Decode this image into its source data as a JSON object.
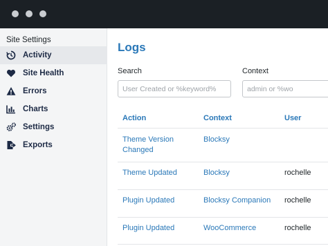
{
  "window": {
    "controls": [
      "close",
      "minimize",
      "maximize"
    ]
  },
  "sidebar": {
    "title": "Site Settings",
    "items": [
      {
        "label": "Activity",
        "icon": "history-icon",
        "active": true
      },
      {
        "label": "Site Health",
        "icon": "heart-icon",
        "active": false
      },
      {
        "label": "Errors",
        "icon": "warning-icon",
        "active": false
      },
      {
        "label": "Charts",
        "icon": "bar-chart-icon",
        "active": false
      },
      {
        "label": "Settings",
        "icon": "gears-icon",
        "active": false
      },
      {
        "label": "Exports",
        "icon": "export-icon",
        "active": false
      }
    ]
  },
  "main": {
    "title": "Logs",
    "filters": {
      "search": {
        "label": "Search",
        "placeholder": "User Created or %keyword%"
      },
      "context": {
        "label": "Context",
        "placeholder": "admin or %wo"
      }
    },
    "table": {
      "columns": [
        "Action",
        "Context",
        "User"
      ],
      "rows": [
        {
          "action": "Theme Version Changed",
          "context": "Blocksy",
          "user": ""
        },
        {
          "action": "Theme Updated",
          "context": "Blocksy",
          "user": "rochelle"
        },
        {
          "action": "Plugin Updated",
          "context": "Blocksy Companion",
          "user": "rochelle"
        },
        {
          "action": "Plugin Updated",
          "context": "WooCommerce",
          "user": "rochelle"
        }
      ]
    }
  },
  "colors": {
    "titlebar": "#1b2025",
    "accent": "#2a78b8",
    "nav_text": "#1d2a45",
    "sidebar_bg": "#f4f5f6",
    "active_bg": "#e6e8eb"
  }
}
